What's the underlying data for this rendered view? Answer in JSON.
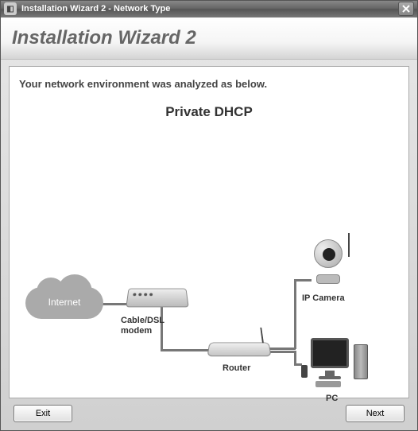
{
  "window": {
    "title": "Installation Wizard 2 - Network Type",
    "app_icon": "wizard-icon"
  },
  "header": {
    "title": "Installation Wizard 2"
  },
  "content": {
    "analysis_text": "Your network environment was analyzed as below.",
    "network_type": "Private DHCP"
  },
  "diagram": {
    "internet_label": "Internet",
    "modem_label": "Cable/DSL\nmodem",
    "modem_label_line1": "Cable/DSL",
    "modem_label_line2": "modem",
    "router_label": "Router",
    "camera_label": "IP Camera",
    "pc_label": "PC"
  },
  "buttons": {
    "exit": "Exit",
    "next": "Next"
  }
}
